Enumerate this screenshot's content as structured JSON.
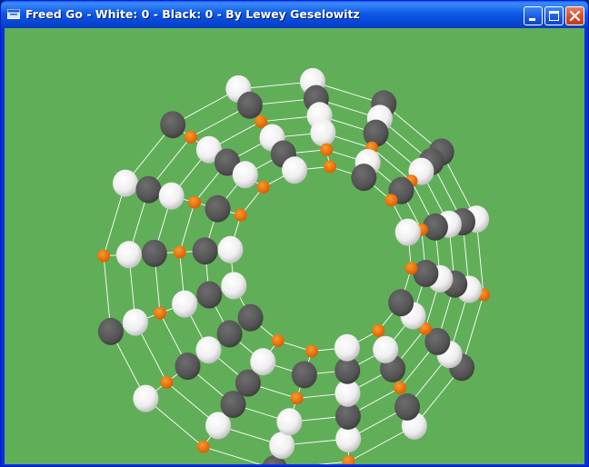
{
  "window": {
    "title": "Freed Go - White: 0 - Black: 0 - By Lewey Geselowitz",
    "icon": "app-window-icon",
    "controls": [
      "minimize-icon",
      "maximize-icon",
      "close-icon"
    ]
  },
  "board": {
    "background_color": "#61ae58",
    "grid_line_color": "#ffffff",
    "empty_point_color": "#ff7a00",
    "white_stone_color": "#f2f2f2",
    "black_stone_color": "#555555"
  }
}
